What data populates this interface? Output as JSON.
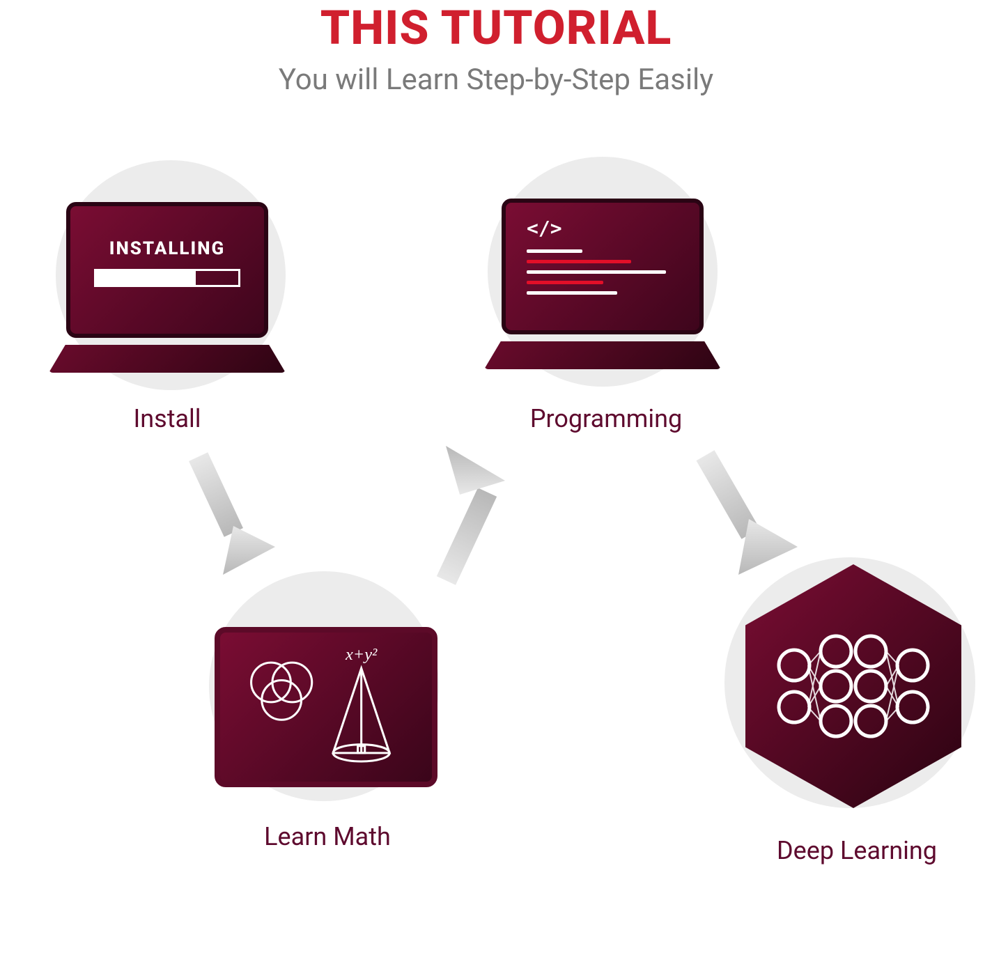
{
  "header": {
    "title": "THIS TUTORIAL",
    "subtitle": "You will Learn Step-by-Step Easily"
  },
  "steps": {
    "install": {
      "label": "Install",
      "screen_text": "INSTALLING"
    },
    "programming": {
      "label": "Programming",
      "code_symbol": "</>"
    },
    "math": {
      "label": "Learn Math",
      "formula": "x+y²"
    },
    "deep": {
      "label": "Deep Learning"
    }
  },
  "colors": {
    "accent_red": "#d01f2e",
    "dark_maroon": "#5e0a2e",
    "bg_circle": "#ececec"
  }
}
